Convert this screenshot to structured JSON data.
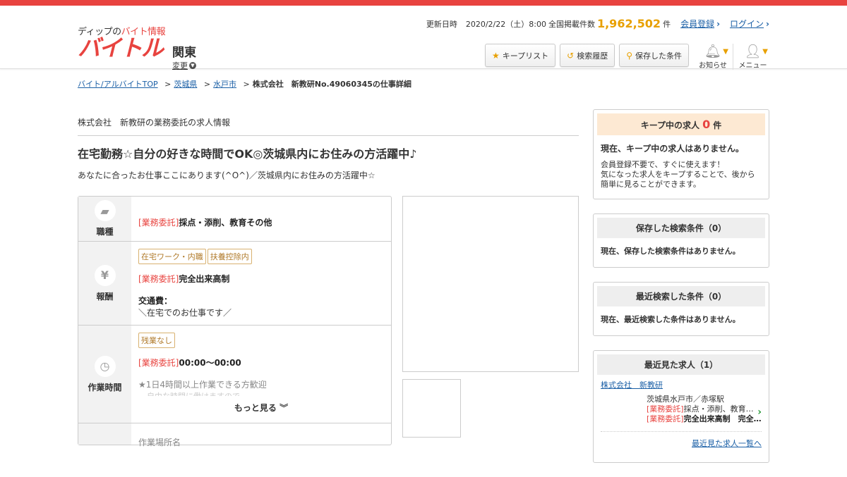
{
  "header": {
    "logo_tag_prefix": "ディップの",
    "logo_tag_red": "バイト情報",
    "logo_main": "バイトル",
    "region": "関東",
    "region_change": "変更",
    "update_label": "更新日時",
    "update_date": "2020/2/22（土）8:00",
    "listing_label": "全国掲載件数",
    "listing_count": "1,962,502",
    "listing_unit": "件",
    "register_link": "会員登録",
    "login_link": "ログイン",
    "keep_list_btn": "キープリスト",
    "history_btn": "検索履歴",
    "saved_btn": "保存した条件",
    "notice_label": "お知らせ",
    "menu_label": "メニュー"
  },
  "breadcrumb": {
    "items": [
      "バイト/アルバイトTOP",
      "茨城県",
      "水戸市"
    ],
    "current": "株式会社　新教研No.49060345の仕事詳細"
  },
  "job": {
    "company": "株式会社　新教研の業務委託の求人情報",
    "title": "在宅勤務☆自分の好きな時間でOK◎茨城県内にお住みの方活躍中♪",
    "subtitle": "あなたに合ったお仕事ここにあります(^O^)／茨城県内にお住みの方活躍中☆",
    "rows": {
      "type_label": "職種",
      "type_cat": "[業務委託]",
      "type_value": "採点・添削、教育その他",
      "pay_label": "報酬",
      "pay_tag1": "在宅ワーク・内職",
      "pay_tag2": "扶養控除内",
      "pay_cat": "[業務委託]",
      "pay_value": "完全出来高制",
      "transport_label": "交通費：",
      "transport_value": "＼在宅でのお仕事です／",
      "time_label": "作業時間",
      "time_tag": "残業なし",
      "time_cat": "[業務委託]",
      "time_value": "00:00～00:00",
      "time_note": "★1日4時間以上作業できる方歓迎",
      "time_note2": "自由な時間に働けますので",
      "more": "もっと見る",
      "place_label": "作業場所名"
    }
  },
  "sidebar": {
    "keep_title": "キープ中の求人",
    "keep_count": "0",
    "keep_unit": "件",
    "keep_empty": "現在、キープ中の求人はありません。",
    "keep_desc1": "会員登録不要で、すぐに使えます！",
    "keep_desc2": "気になった求人をキープすることで、後から",
    "keep_desc3": "簡単に見ることができます。",
    "saved_title": "保存した検索条件（0）",
    "saved_empty": "現在、保存した検索条件はありません。",
    "recent_search_title": "最近検索した条件（0）",
    "recent_search_empty": "現在、最近検索した条件はありません。",
    "recent_view_title": "最近見た求人（1）",
    "recent_company": "株式会社　新教研",
    "recent_loc": "茨城県水戸市／赤塚駅",
    "recent_cat1": "[業務委託]",
    "recent_type": "採点・添削、教育…",
    "recent_cat2": "[業務委託]",
    "recent_pay": "完全出来高制　完全…",
    "recent_all": "最近見た求人一覧へ"
  },
  "colors": {
    "accent": "#e8433f",
    "link": "#1a5fa6",
    "highlight": "#e8a000"
  }
}
